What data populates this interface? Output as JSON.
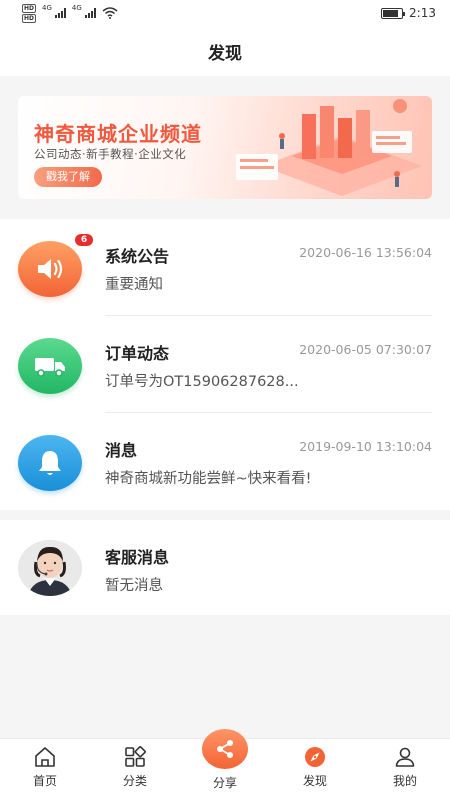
{
  "status_bar": {
    "network_left": "HD",
    "network_type_1": "4G",
    "network_type_2": "4G",
    "time": "2:13",
    "battery_level": 0.85
  },
  "header": {
    "title": "发现"
  },
  "banner": {
    "title": "神奇商城企业频道",
    "subtitle": "公司动态·新手教程·企业文化",
    "button_label": "戳我了解"
  },
  "messages": [
    {
      "title": "系统公告",
      "time": "2020-06-16 13:56:04",
      "subtitle": "重要通知",
      "badge": "6",
      "icon": "speaker-icon",
      "color": "#f26436"
    },
    {
      "title": "订单动态",
      "time": "2020-06-05 07:30:07",
      "subtitle": "订单号为OT15906287628...",
      "icon": "truck-icon",
      "color": "#21b764"
    },
    {
      "title": "消息",
      "time": "2019-09-10 13:10:04",
      "subtitle": "神奇商城新功能尝鲜~快来看看!",
      "icon": "bell-icon",
      "color": "#1a8fd8"
    }
  ],
  "service": {
    "title": "客服消息",
    "subtitle": "暂无消息"
  },
  "tabs": [
    {
      "label": "首页",
      "icon": "home-icon"
    },
    {
      "label": "分类",
      "icon": "category-icon"
    },
    {
      "label": "分享",
      "icon": "share-icon"
    },
    {
      "label": "发现",
      "icon": "compass-icon"
    },
    {
      "label": "我的",
      "icon": "user-icon"
    }
  ],
  "colors": {
    "accent": "#f26436",
    "active_tab": "#f26436"
  }
}
